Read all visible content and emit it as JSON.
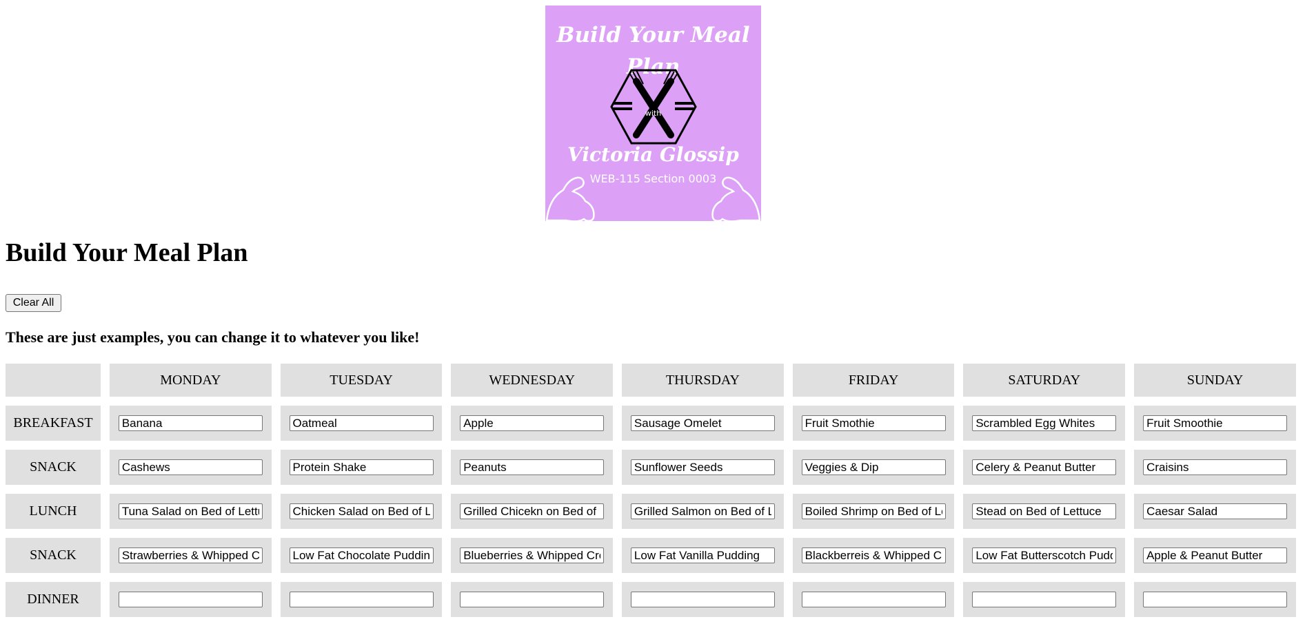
{
  "logo": {
    "title": "Build Your Meal Plan",
    "with": "with",
    "name": "Victoria Glossip",
    "subtitle": "WEB-115 Section 0003",
    "background": "#dda0f7"
  },
  "page": {
    "title": "Build Your Meal Plan",
    "clear_label": "Clear All",
    "note": "These are just examples, you can change it to whatever you like!"
  },
  "table": {
    "days": [
      "MONDAY",
      "TUESDAY",
      "WEDNESDAY",
      "THURSDAY",
      "FRIDAY",
      "SATURDAY",
      "SUNDAY"
    ],
    "rows": [
      {
        "label": "BREAKFAST",
        "values": [
          "Banana",
          "Oatmeal",
          "Apple",
          "Sausage Omelet",
          "Fruit Smothie",
          "Scrambled Egg Whites",
          "Fruit Smoothie"
        ]
      },
      {
        "label": "SNACK",
        "values": [
          "Cashews",
          "Protein Shake",
          "Peanuts",
          "Sunflower Seeds",
          "Veggies & Dip",
          "Celery & Peanut Butter",
          "Craisins"
        ]
      },
      {
        "label": "LUNCH",
        "values": [
          "Tuna Salad on Bed of Lettuce",
          "Chicken Salad on Bed of Lettuce",
          "Grilled Chicekn on Bed of Lettuce",
          "Grilled Salmon on Bed of Lettuce",
          "Boiled Shrimp on Bed of Lettuce",
          "Stead on Bed of Lettuce",
          "Caesar Salad"
        ]
      },
      {
        "label": "SNACK",
        "values": [
          "Strawberries & Whipped Cream",
          "Low Fat Chocolate Pudding",
          "Blueberries & Whipped Cream",
          "Low Fat Vanilla Pudding",
          "Blackberreis & Whipped Cream",
          "Low Fat Butterscotch Pudding",
          "Apple & Peanut Butter"
        ]
      },
      {
        "label": "DINNER",
        "values": [
          "",
          "",
          "",
          "",
          "",
          "",
          ""
        ]
      }
    ]
  }
}
